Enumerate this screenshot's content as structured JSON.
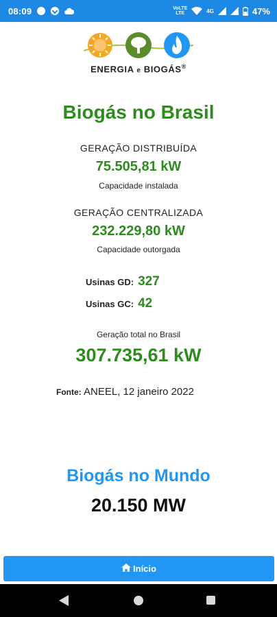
{
  "status_bar": {
    "time": "08:09",
    "network_top": "VoLTE",
    "network_bottom": "LTE",
    "signal_tag": "4G",
    "battery": "47%"
  },
  "logo": {
    "name_part1": "ENERGIA",
    "name_conj": "e",
    "name_part2": "BIOGÁS",
    "registered": "®"
  },
  "brasil": {
    "title": "Biogás no Brasil",
    "gd_label": "GERAÇÃO DISTRIBUÍDA",
    "gd_value": "75.505,81 kW",
    "gd_caption": "Capacidade instalada",
    "gc_label": "GERAÇÃO CENTRALIZADA",
    "gc_value": "232.229,80 kW",
    "gc_caption": "Capacidade outorgada",
    "usinas_gd_label": "Usinas GD:",
    "usinas_gd_value": "327",
    "usinas_gc_label": "Usinas GC:",
    "usinas_gc_value": "42",
    "total_label": "Geração total no Brasil",
    "total_value": "307.735,61 kW",
    "fonte_label": "Fonte:",
    "fonte_value": "ANEEL, 12 janeiro 2022"
  },
  "mundo": {
    "title": "Biogás no Mundo",
    "value": "20.150 MW"
  },
  "button": {
    "home_label": "Início"
  },
  "colors": {
    "status_bar": "#1e88e5",
    "green": "#2e8b1e",
    "blue": "#2196f3"
  }
}
